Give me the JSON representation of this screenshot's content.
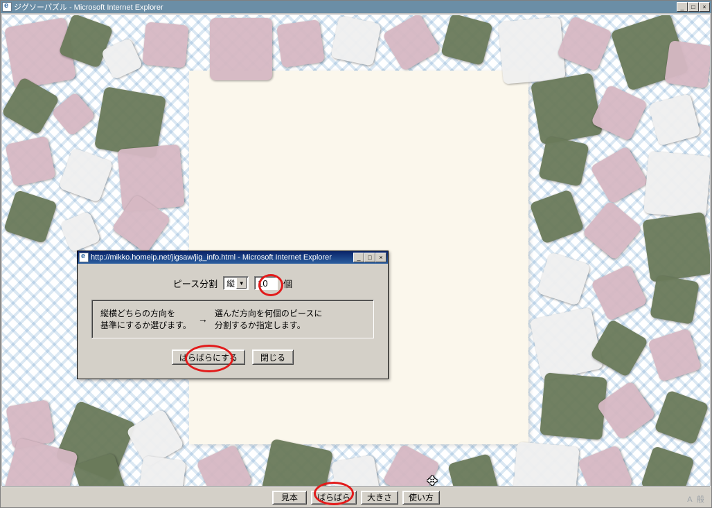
{
  "main_window": {
    "title": "ジグソーパズル - Microsoft Internet Explorer"
  },
  "bottom_toolbar": {
    "sample_label": "見本",
    "scatter_label": "ばらばら",
    "size_label": "大きさ",
    "howto_label": "使い方"
  },
  "ime_status": "A 般",
  "dialog": {
    "title": "http://mikko.homeip.net/jigsaw/jig_info.html - Microsoft Internet Explorer",
    "split_label": "ピース分割",
    "direction_selected": "縦",
    "count_value": "10",
    "unit_label": "個",
    "help_left": "縦横どちらの方向を\n基準にするか選びます。",
    "help_right": "選んだ方向を何個のピースに\n分割するか指定します。",
    "scatter_button": "ばらばらにする",
    "close_button": "閉じる"
  }
}
